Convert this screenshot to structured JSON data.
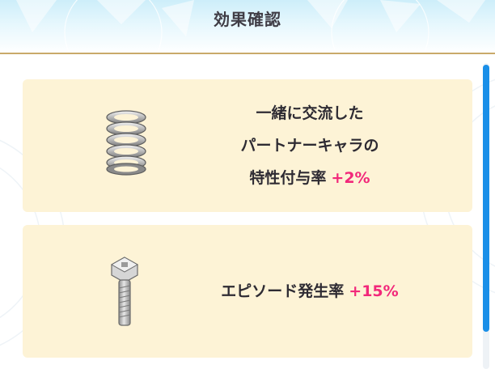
{
  "header": {
    "title": "効果確認"
  },
  "effects": [
    {
      "icon": "spring-icon",
      "lines": [
        "一緒に交流した",
        "パートナーキャラの",
        "特性付与率"
      ],
      "value": "+2%"
    },
    {
      "icon": "bolt-icon",
      "lines": [
        "エピソード発生率"
      ],
      "value": "+15%"
    }
  ],
  "colors": {
    "accent": "#f2287a",
    "card_background": "#fdf3d6",
    "header_rule": "#c9a96a",
    "scrollbar": "#1a8fe8"
  }
}
